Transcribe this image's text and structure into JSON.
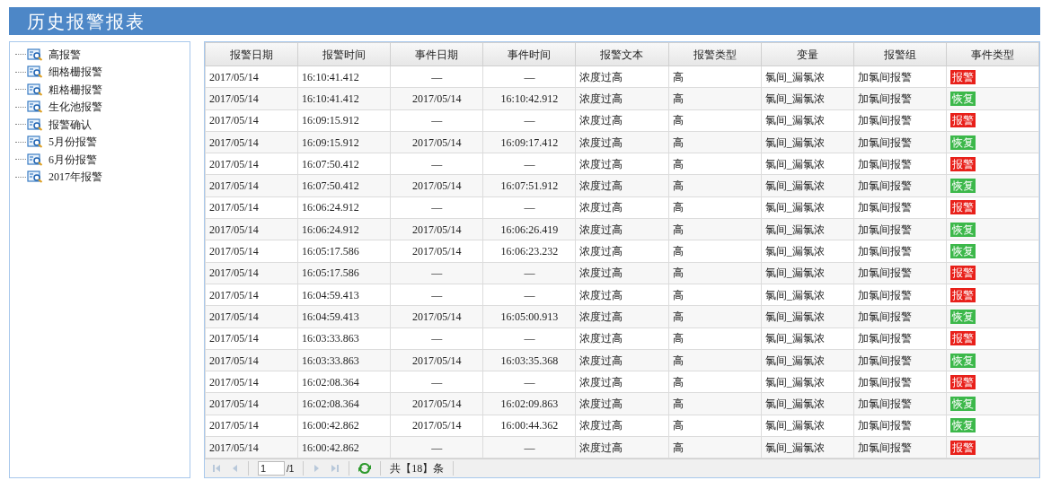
{
  "title": "历史报警报表",
  "tree": [
    {
      "label": "高报警"
    },
    {
      "label": "细格栅报警"
    },
    {
      "label": "粗格栅报警"
    },
    {
      "label": "生化池报警"
    },
    {
      "label": "报警确认"
    },
    {
      "label": "5月份报警"
    },
    {
      "label": "6月份报警"
    },
    {
      "label": "2017年报警"
    }
  ],
  "table": {
    "columns": [
      "报警日期",
      "报警时间",
      "事件日期",
      "事件时间",
      "报警文本",
      "报警类型",
      "变量",
      "报警组",
      "事件类型"
    ],
    "rows": [
      [
        "2017/05/14",
        "16:10:41.412",
        "—",
        "—",
        "浓度过高",
        "高",
        "氯间_漏氯浓",
        "加氯间报警",
        {
          "kind": "alarm",
          "text": "报警"
        }
      ],
      [
        "2017/05/14",
        "16:10:41.412",
        "2017/05/14",
        "16:10:42.912",
        "浓度过高",
        "高",
        "氯间_漏氯浓",
        "加氯间报警",
        {
          "kind": "recover",
          "text": "恢复"
        }
      ],
      [
        "2017/05/14",
        "16:09:15.912",
        "—",
        "—",
        "浓度过高",
        "高",
        "氯间_漏氯浓",
        "加氯间报警",
        {
          "kind": "alarm",
          "text": "报警"
        }
      ],
      [
        "2017/05/14",
        "16:09:15.912",
        "2017/05/14",
        "16:09:17.412",
        "浓度过高",
        "高",
        "氯间_漏氯浓",
        "加氯间报警",
        {
          "kind": "recover",
          "text": "恢复"
        }
      ],
      [
        "2017/05/14",
        "16:07:50.412",
        "—",
        "—",
        "浓度过高",
        "高",
        "氯间_漏氯浓",
        "加氯间报警",
        {
          "kind": "alarm",
          "text": "报警"
        }
      ],
      [
        "2017/05/14",
        "16:07:50.412",
        "2017/05/14",
        "16:07:51.912",
        "浓度过高",
        "高",
        "氯间_漏氯浓",
        "加氯间报警",
        {
          "kind": "recover",
          "text": "恢复"
        }
      ],
      [
        "2017/05/14",
        "16:06:24.912",
        "—",
        "—",
        "浓度过高",
        "高",
        "氯间_漏氯浓",
        "加氯间报警",
        {
          "kind": "alarm",
          "text": "报警"
        }
      ],
      [
        "2017/05/14",
        "16:06:24.912",
        "2017/05/14",
        "16:06:26.419",
        "浓度过高",
        "高",
        "氯间_漏氯浓",
        "加氯间报警",
        {
          "kind": "recover",
          "text": "恢复"
        }
      ],
      [
        "2017/05/14",
        "16:05:17.586",
        "2017/05/14",
        "16:06:23.232",
        "浓度过高",
        "高",
        "氯间_漏氯浓",
        "加氯间报警",
        {
          "kind": "recover",
          "text": "恢复"
        }
      ],
      [
        "2017/05/14",
        "16:05:17.586",
        "—",
        "—",
        "浓度过高",
        "高",
        "氯间_漏氯浓",
        "加氯间报警",
        {
          "kind": "alarm",
          "text": "报警"
        }
      ],
      [
        "2017/05/14",
        "16:04:59.413",
        "—",
        "—",
        "浓度过高",
        "高",
        "氯间_漏氯浓",
        "加氯间报警",
        {
          "kind": "alarm",
          "text": "报警"
        }
      ],
      [
        "2017/05/14",
        "16:04:59.413",
        "2017/05/14",
        "16:05:00.913",
        "浓度过高",
        "高",
        "氯间_漏氯浓",
        "加氯间报警",
        {
          "kind": "recover",
          "text": "恢复"
        }
      ],
      [
        "2017/05/14",
        "16:03:33.863",
        "—",
        "—",
        "浓度过高",
        "高",
        "氯间_漏氯浓",
        "加氯间报警",
        {
          "kind": "alarm",
          "text": "报警"
        }
      ],
      [
        "2017/05/14",
        "16:03:33.863",
        "2017/05/14",
        "16:03:35.368",
        "浓度过高",
        "高",
        "氯间_漏氯浓",
        "加氯间报警",
        {
          "kind": "recover",
          "text": "恢复"
        }
      ],
      [
        "2017/05/14",
        "16:02:08.364",
        "—",
        "—",
        "浓度过高",
        "高",
        "氯间_漏氯浓",
        "加氯间报警",
        {
          "kind": "alarm",
          "text": "报警"
        }
      ],
      [
        "2017/05/14",
        "16:02:08.364",
        "2017/05/14",
        "16:02:09.863",
        "浓度过高",
        "高",
        "氯间_漏氯浓",
        "加氯间报警",
        {
          "kind": "recover",
          "text": "恢复"
        }
      ],
      [
        "2017/05/14",
        "16:00:42.862",
        "2017/05/14",
        "16:00:44.362",
        "浓度过高",
        "高",
        "氯间_漏氯浓",
        "加氯间报警",
        {
          "kind": "recover",
          "text": "恢复"
        }
      ],
      [
        "2017/05/14",
        "16:00:42.862",
        "—",
        "—",
        "浓度过高",
        "高",
        "氯间_漏氯浓",
        "加氯间报警",
        {
          "kind": "alarm",
          "text": "报警"
        }
      ]
    ]
  },
  "pager": {
    "page": "1",
    "page_count": "/1",
    "total": "共【18】条"
  }
}
